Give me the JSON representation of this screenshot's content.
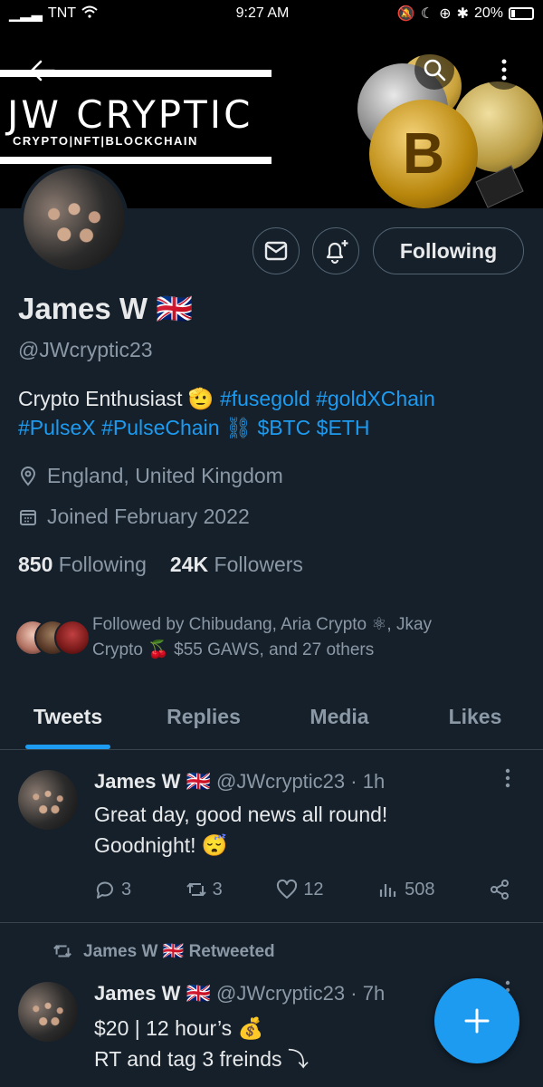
{
  "status_bar": {
    "carrier": "TNT",
    "time": "9:27 AM",
    "battery": "20%",
    "battery_level": 0.2
  },
  "banner": {
    "title": "JW CRYPTIC",
    "subtitle": "CRYPTO|NFT|BLOCKCHAIN",
    "coin_btc_symbol": "B",
    "colors": {
      "accent_gold": "#c9a13a"
    }
  },
  "header": {
    "back_icon": "arrow-left-icon",
    "search_icon": "search-icon",
    "more_icon": "more-vertical-icon"
  },
  "profile": {
    "name": "James W 🇬🇧",
    "handle": "@JWcryptic23",
    "bio_plain": "Crypto Enthusiast 🫡 ",
    "bio_tags": [
      "#fusegold",
      "#goldXChain",
      "#PulseX",
      "#PulseChain"
    ],
    "bio_link_emoji": "⛓",
    "bio_cashtags": [
      "$BTC",
      "$ETH"
    ],
    "location": "England, United Kingdom",
    "joined": "Joined February 2022",
    "following_count": "850",
    "following_label": "Following",
    "followers_count": "24K",
    "followers_label": "Followers",
    "followed_by": "Followed by Chibudang, Aria Crypto ⚛, Jkay Crypto 🍒 $55 GAWS, and 27 others"
  },
  "actions": {
    "following_button": "Following",
    "mail_icon": "mail-icon",
    "notify_icon": "bell-plus-icon"
  },
  "tabs": [
    {
      "label": "Tweets",
      "active": true
    },
    {
      "label": "Replies",
      "active": false
    },
    {
      "label": "Media",
      "active": false
    },
    {
      "label": "Likes",
      "active": false
    }
  ],
  "tweets": [
    {
      "author": "James W 🇬🇧",
      "handle": "@JWcryptic23",
      "time": "· 1h",
      "text_line1": "Great day, good news all round!",
      "text_line2": "Goodnight! 😴",
      "replies": "3",
      "retweets": "3",
      "likes": "12",
      "views": "508"
    },
    {
      "retweeted_by": "James W 🇬🇧 Retweeted",
      "author": "James W 🇬🇧",
      "handle": "@JWcryptic23",
      "time": "· 7h",
      "text_line1": "$20 | 12 hour’s 💰",
      "text_line2": "RT and tag 3 freinds ⤵"
    }
  ],
  "fab": {
    "label": "+"
  },
  "colors": {
    "background": "#15202b",
    "accent": "#1d9bf0",
    "secondary_text": "#8b98a5",
    "divider": "#38444d"
  }
}
